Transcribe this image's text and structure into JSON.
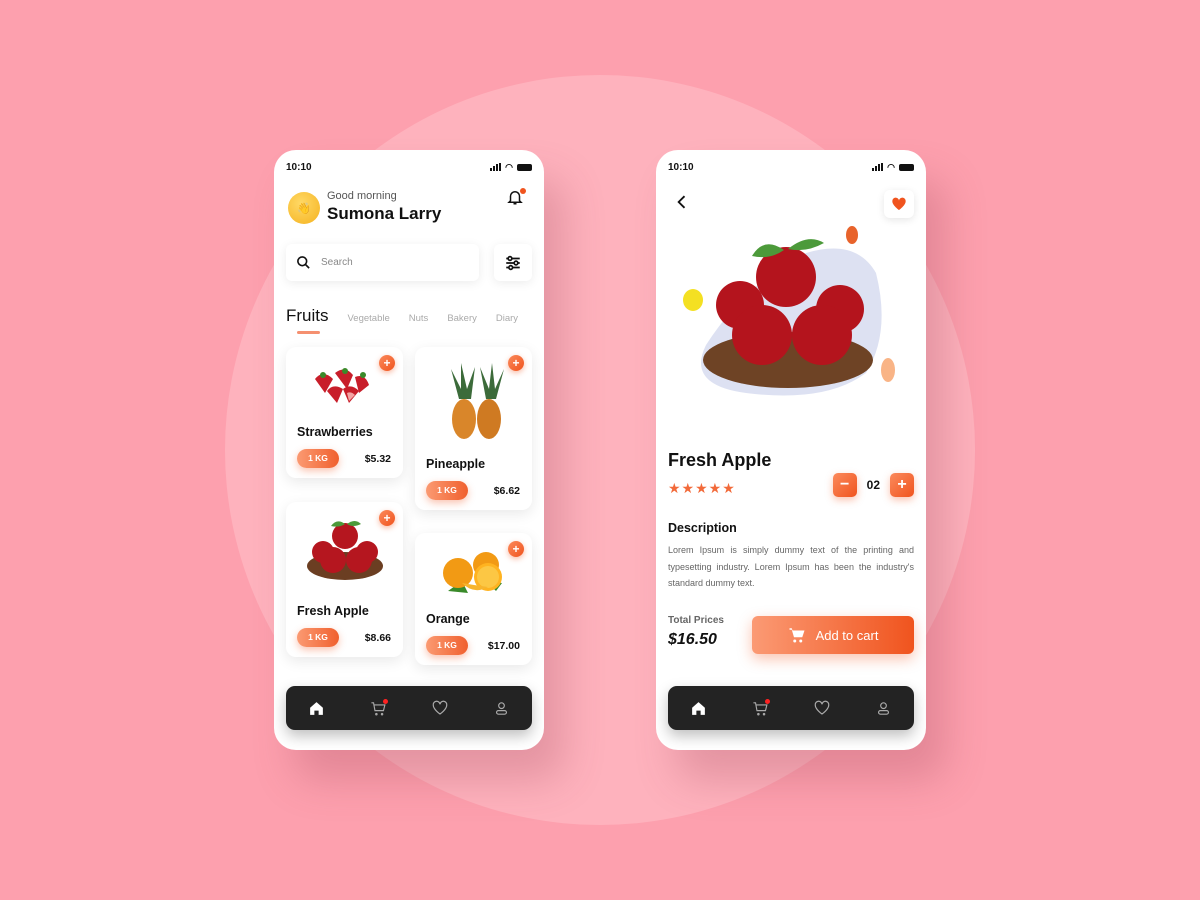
{
  "status": {
    "time": "10:10"
  },
  "home": {
    "greeting": "Good morning",
    "user_name": "Sumona Larry",
    "search_placeholder": "Search",
    "tabs": [
      {
        "label": "Fruits",
        "active": true
      },
      {
        "label": "Vegetable"
      },
      {
        "label": "Nuts"
      },
      {
        "label": "Bakery"
      },
      {
        "label": "Diary"
      }
    ],
    "products": [
      {
        "name": "Strawberries",
        "unit": "1 KG",
        "price": "$5.32",
        "icon": "strawberry"
      },
      {
        "name": "Pineapple",
        "unit": "1 KG",
        "price": "$6.62",
        "icon": "pineapple"
      },
      {
        "name": "Fresh Apple",
        "unit": "1 KG",
        "price": "$8.66",
        "icon": "apple"
      },
      {
        "name": "Orange",
        "unit": "1 KG",
        "price": "$17.00",
        "icon": "orange"
      }
    ],
    "add_symbol": "+"
  },
  "detail": {
    "title": "Fresh Apple",
    "rating": 5,
    "stars": "★★★★★",
    "quantity": "02",
    "minus": "−",
    "plus": "+",
    "description_title": "Description",
    "description": "Lorem Ipsum is simply dummy text of the printing and typesetting industry. Lorem Ipsum has been the industry's standard dummy text.",
    "total_label": "Total Prices",
    "total_value": "$16.50",
    "add_to_cart": "Add to cart"
  },
  "nav": [
    "home",
    "cart",
    "favorites",
    "profile"
  ],
  "colors": {
    "accent": "#f0541e",
    "background": "#fda0ae",
    "nav": "#232323"
  }
}
